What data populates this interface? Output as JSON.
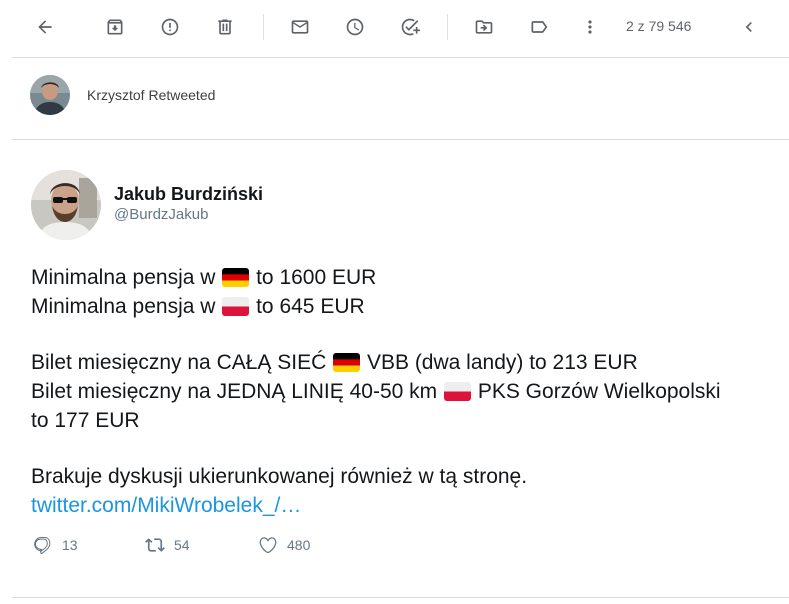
{
  "toolbar": {
    "icons": {
      "back": "arrow-left-icon",
      "archive": "archive-icon",
      "report": "report-spam-icon",
      "delete": "trash-icon",
      "mark_unread": "mail-icon",
      "snooze": "clock-icon",
      "add_task": "add-task-icon",
      "move": "move-to-icon",
      "label": "label-icon",
      "more": "more-vertical-icon",
      "older": "chevron-left-icon"
    },
    "pager": "2 z 79 546"
  },
  "retweet": {
    "text": "Krzysztof Retweeted"
  },
  "tweet": {
    "author_name": "Jakub Burdziński",
    "author_handle": "@BurdzJakub",
    "lines": {
      "l1a": "Minimalna pensja w ",
      "l1b": " to 1600 EUR",
      "l2a": "Minimalna pensja w ",
      "l2b": " to 645 EUR",
      "l3a": "Bilet miesięczny na CAŁĄ SIEĆ ",
      "l3b": " VBB (dwa landy) to 213 EUR",
      "l4a": "Bilet miesięczny na JEDNĄ LINIĘ 40-50 km ",
      "l4b": " PKS Gorzów Wielkopolski",
      "l5": "to 177 EUR",
      "l6": "Brakuje dyskusji ukierunkowanej również w tą stronę.",
      "link": "twitter.com/MikiWrobelek_/…"
    },
    "flags": {
      "germany": "germany-flag-icon",
      "poland": "poland-flag-icon"
    },
    "stats": {
      "replies": "13",
      "retweets": "54",
      "likes": "480"
    }
  },
  "colors": {
    "link": "#1b95e0",
    "muted": "#657786",
    "divider": "#dadce0",
    "toolbar_icon": "#5f6368"
  }
}
